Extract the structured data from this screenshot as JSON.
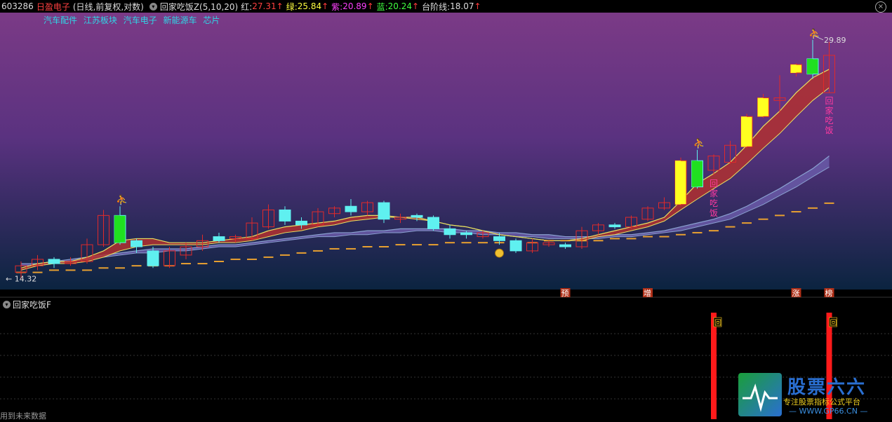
{
  "header": {
    "code": "603286",
    "name": "日盈电子",
    "mode": "(日线,前复权,对数)",
    "indicator": "回家吃饭Z(5,10,20)",
    "red_label": "红:",
    "red_value": "27.31",
    "green_label": "绿:",
    "green_value": "25.84",
    "purple_label": "紫:",
    "purple_value": "20.89",
    "blue_label": "蓝:",
    "blue_value": "20.24",
    "step_label": "台阶线:",
    "step_value": "18.07",
    "arrow": "↑",
    "close_icon": "×"
  },
  "sectors": [
    "汽车配件",
    "江苏板块",
    "汽车电子",
    "新能源车",
    "芯片"
  ],
  "sub_indicator": "回家吃饭F",
  "footer_note": "用到未来数据",
  "watermark": {
    "title": "股票六六",
    "sub": "专注股票指标公式平台",
    "url": "— WWW.GP66.CN —"
  },
  "colors": {
    "bg_top": "#7b3a86",
    "bg_bottom": "#0b2440",
    "up_candle": "#e02a2a",
    "down_candle": "#5ff0f0",
    "highlight_up": "#ffff20",
    "highlight_green": "#20e020",
    "ribbon_red": "#b03030",
    "ribbon_blue": "#8aa0d0",
    "step_line": "#e8a030",
    "signal_bar": "#ff1a1a",
    "magenta_text": "#ff3aa0"
  },
  "chart_data": {
    "type": "candlestick",
    "price_labels": {
      "high": "29.89",
      "low": "14.32"
    },
    "ylim": [
      14.0,
      31.0
    ],
    "log_scale": true,
    "candles": [
      {
        "o": 14.6,
        "c": 14.9,
        "h": 15.1,
        "l": 14.3,
        "s": "up"
      },
      {
        "o": 14.9,
        "c": 15.2,
        "h": 15.4,
        "l": 14.7,
        "s": "up"
      },
      {
        "o": 15.2,
        "c": 15.0,
        "h": 15.3,
        "l": 14.8,
        "s": "down"
      },
      {
        "o": 15.0,
        "c": 15.1,
        "h": 15.3,
        "l": 14.9,
        "s": "up"
      },
      {
        "o": 15.1,
        "c": 15.9,
        "h": 16.2,
        "l": 15.0,
        "s": "up"
      },
      {
        "o": 15.9,
        "c": 17.4,
        "h": 17.7,
        "l": 15.8,
        "s": "up"
      },
      {
        "o": 16.0,
        "c": 17.4,
        "h": 17.9,
        "l": 15.9,
        "s": "upg"
      },
      {
        "o": 16.1,
        "c": 15.8,
        "h": 16.2,
        "l": 15.5,
        "s": "down"
      },
      {
        "o": 15.6,
        "c": 14.9,
        "h": 15.8,
        "l": 14.8,
        "s": "down"
      },
      {
        "o": 14.9,
        "c": 15.6,
        "h": 15.8,
        "l": 14.8,
        "s": "up"
      },
      {
        "o": 15.4,
        "c": 15.8,
        "h": 16.0,
        "l": 15.2,
        "s": "up"
      },
      {
        "o": 15.8,
        "c": 16.1,
        "h": 16.4,
        "l": 15.6,
        "s": "up"
      },
      {
        "o": 16.1,
        "c": 16.3,
        "h": 16.5,
        "l": 16.0,
        "s": "down"
      },
      {
        "o": 16.3,
        "c": 16.2,
        "h": 16.4,
        "l": 16.0,
        "s": "up"
      },
      {
        "o": 16.2,
        "c": 17.0,
        "h": 17.3,
        "l": 16.1,
        "s": "up"
      },
      {
        "o": 16.8,
        "c": 17.7,
        "h": 18.0,
        "l": 16.7,
        "s": "up"
      },
      {
        "o": 17.7,
        "c": 17.1,
        "h": 17.9,
        "l": 16.9,
        "s": "down"
      },
      {
        "o": 17.1,
        "c": 16.9,
        "h": 17.3,
        "l": 16.7,
        "s": "down"
      },
      {
        "o": 16.9,
        "c": 17.6,
        "h": 17.8,
        "l": 16.8,
        "s": "up"
      },
      {
        "o": 17.5,
        "c": 17.8,
        "h": 17.9,
        "l": 17.3,
        "s": "up"
      },
      {
        "o": 17.9,
        "c": 17.6,
        "h": 18.3,
        "l": 17.4,
        "s": "down"
      },
      {
        "o": 17.6,
        "c": 18.1,
        "h": 18.2,
        "l": 17.4,
        "s": "up"
      },
      {
        "o": 18.1,
        "c": 17.2,
        "h": 18.2,
        "l": 17.0,
        "s": "down"
      },
      {
        "o": 17.2,
        "c": 17.3,
        "h": 17.5,
        "l": 17.0,
        "s": "up"
      },
      {
        "o": 17.4,
        "c": 17.3,
        "h": 17.5,
        "l": 17.1,
        "s": "down"
      },
      {
        "o": 17.3,
        "c": 16.7,
        "h": 17.4,
        "l": 16.6,
        "s": "down"
      },
      {
        "o": 16.7,
        "c": 16.4,
        "h": 16.9,
        "l": 16.2,
        "s": "down"
      },
      {
        "o": 16.4,
        "c": 16.5,
        "h": 16.6,
        "l": 16.2,
        "s": "down"
      },
      {
        "o": 16.5,
        "c": 16.3,
        "h": 16.6,
        "l": 16.2,
        "s": "up"
      },
      {
        "o": 16.3,
        "c": 16.1,
        "h": 16.5,
        "l": 15.9,
        "s": "down"
      },
      {
        "o": 16.1,
        "c": 15.6,
        "h": 16.2,
        "l": 15.5,
        "s": "down"
      },
      {
        "o": 15.6,
        "c": 16.0,
        "h": 16.2,
        "l": 15.5,
        "s": "up"
      },
      {
        "o": 16.0,
        "c": 15.9,
        "h": 16.1,
        "l": 15.8,
        "s": "up"
      },
      {
        "o": 15.9,
        "c": 15.8,
        "h": 16.0,
        "l": 15.7,
        "s": "down"
      },
      {
        "o": 15.8,
        "c": 16.6,
        "h": 16.8,
        "l": 15.7,
        "s": "up"
      },
      {
        "o": 16.6,
        "c": 16.9,
        "h": 17.0,
        "l": 16.4,
        "s": "up"
      },
      {
        "o": 16.9,
        "c": 16.8,
        "h": 17.0,
        "l": 16.7,
        "s": "down"
      },
      {
        "o": 16.8,
        "c": 17.3,
        "h": 17.4,
        "l": 16.7,
        "s": "up"
      },
      {
        "o": 17.2,
        "c": 17.8,
        "h": 17.9,
        "l": 17.1,
        "s": "up"
      },
      {
        "o": 17.8,
        "c": 18.1,
        "h": 18.4,
        "l": 17.7,
        "s": "up"
      },
      {
        "o": 18.0,
        "c": 20.6,
        "h": 20.8,
        "l": 17.9,
        "s": "upy"
      },
      {
        "o": 19.0,
        "c": 20.6,
        "h": 21.3,
        "l": 18.9,
        "s": "upg"
      },
      {
        "o": 20.0,
        "c": 20.9,
        "h": 21.0,
        "l": 19.7,
        "s": "up"
      },
      {
        "o": 20.5,
        "c": 21.6,
        "h": 21.9,
        "l": 20.4,
        "s": "up"
      },
      {
        "o": 21.5,
        "c": 23.6,
        "h": 23.8,
        "l": 21.4,
        "s": "upy"
      },
      {
        "o": 23.6,
        "c": 25.0,
        "h": 25.3,
        "l": 23.5,
        "s": "upy"
      },
      {
        "o": 25.0,
        "c": 24.8,
        "h": 26.8,
        "l": 23.9,
        "s": "up"
      },
      {
        "o": 27.0,
        "c": 27.7,
        "h": 27.8,
        "l": 26.7,
        "s": "upy"
      },
      {
        "o": 26.9,
        "c": 28.2,
        "h": 29.89,
        "l": 26.5,
        "s": "upg"
      },
      {
        "o": 28.5,
        "c": 25.4,
        "h": 29.7,
        "l": 25.4,
        "s": "upred"
      }
    ],
    "ribbon_upper": [
      14.8,
      15.0,
      15.1,
      15.1,
      15.3,
      15.6,
      16.1,
      16.2,
      16.2,
      16.0,
      16.0,
      16.0,
      16.1,
      16.2,
      16.3,
      16.6,
      16.8,
      16.9,
      17.0,
      17.1,
      17.3,
      17.4,
      17.4,
      17.3,
      17.3,
      17.1,
      16.9,
      16.8,
      16.6,
      16.4,
      16.3,
      16.2,
      16.1,
      16.1,
      16.2,
      16.4,
      16.6,
      16.8,
      17.0,
      17.3,
      18.2,
      19.2,
      19.8,
      20.5,
      21.6,
      22.9,
      24.0,
      25.4,
      26.6,
      27.3
    ],
    "ribbon_lower": [
      14.7,
      14.9,
      15.0,
      15.0,
      15.1,
      15.3,
      15.6,
      15.8,
      15.9,
      15.9,
      15.9,
      15.9,
      16.0,
      16.0,
      16.1,
      16.3,
      16.5,
      16.6,
      16.8,
      16.9,
      17.1,
      17.2,
      17.3,
      17.3,
      17.2,
      17.1,
      16.9,
      16.8,
      16.6,
      16.4,
      16.3,
      16.2,
      16.1,
      16.1,
      16.1,
      16.3,
      16.4,
      16.6,
      16.8,
      17.1,
      17.7,
      18.3,
      18.9,
      19.5,
      20.4,
      21.4,
      22.4,
      23.6,
      24.8,
      25.8
    ],
    "blue_upper": [
      15.0,
      15.0,
      15.1,
      15.2,
      15.3,
      15.4,
      15.5,
      15.6,
      15.7,
      15.7,
      15.7,
      15.8,
      15.9,
      15.9,
      16.0,
      16.1,
      16.2,
      16.3,
      16.4,
      16.5,
      16.5,
      16.6,
      16.6,
      16.7,
      16.7,
      16.7,
      16.7,
      16.6,
      16.6,
      16.5,
      16.5,
      16.4,
      16.4,
      16.3,
      16.3,
      16.3,
      16.4,
      16.4,
      16.5,
      16.6,
      16.8,
      17.0,
      17.2,
      17.5,
      17.9,
      18.4,
      18.9,
      19.5,
      20.1,
      20.9
    ],
    "blue_lower": [
      14.9,
      14.9,
      15.0,
      15.1,
      15.2,
      15.3,
      15.4,
      15.5,
      15.5,
      15.6,
      15.6,
      15.7,
      15.8,
      15.8,
      15.9,
      16.0,
      16.1,
      16.2,
      16.3,
      16.3,
      16.4,
      16.4,
      16.5,
      16.5,
      16.6,
      16.6,
      16.5,
      16.5,
      16.4,
      16.4,
      16.3,
      16.3,
      16.2,
      16.2,
      16.2,
      16.2,
      16.3,
      16.3,
      16.4,
      16.5,
      16.6,
      16.8,
      17.0,
      17.2,
      17.6,
      18.0,
      18.5,
      19.0,
      19.6,
      20.2
    ],
    "step_line": [
      14.6,
      14.6,
      14.7,
      14.7,
      14.7,
      14.8,
      14.8,
      14.9,
      14.9,
      14.9,
      15.0,
      15.0,
      15.1,
      15.2,
      15.2,
      15.3,
      15.4,
      15.5,
      15.6,
      15.7,
      15.7,
      15.8,
      15.8,
      15.9,
      15.9,
      15.9,
      16.0,
      16.0,
      16.0,
      16.0,
      16.0,
      16.0,
      16.1,
      16.1,
      16.1,
      16.1,
      16.2,
      16.2,
      16.3,
      16.3,
      16.4,
      16.5,
      16.6,
      16.8,
      17.0,
      17.2,
      17.4,
      17.6,
      17.8,
      18.07
    ],
    "star_markers": [
      6,
      41,
      48
    ],
    "money_marker": 29,
    "magenta_labels": [
      {
        "i": 42,
        "text": "回家吃饭"
      },
      {
        "i": 49,
        "text": "回家吃饭"
      }
    ],
    "bottom_tags": [
      {
        "i": 33,
        "text": "预"
      },
      {
        "i": 38,
        "text": "增"
      },
      {
        "i": 47,
        "text": "涨"
      },
      {
        "i": 49,
        "text": "榜"
      }
    ],
    "signals": [
      {
        "i": 42,
        "text": "回"
      },
      {
        "i": 49,
        "text": "回"
      }
    ]
  }
}
